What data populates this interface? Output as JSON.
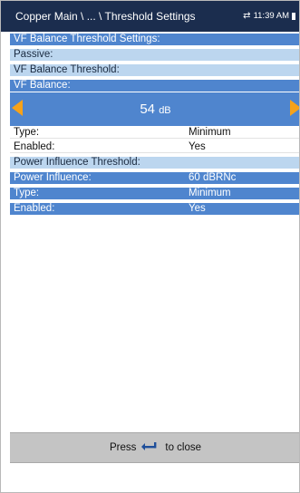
{
  "header": {
    "breadcrumb": "Copper Main \\ ... \\ Threshold Settings",
    "time": "11:39 AM"
  },
  "sections": {
    "vf_settings_title": "VF Balance Threshold Settings:",
    "passive_label": "Passive:",
    "vf_threshold_title": "VF Balance Threshold:",
    "vf_balance_label": "VF Balance:"
  },
  "editor": {
    "value": "54",
    "unit": "dB"
  },
  "vf_rows": [
    {
      "label": "Type:",
      "value": "Minimum"
    },
    {
      "label": "Enabled:",
      "value": "Yes"
    }
  ],
  "power": {
    "title": "Power Influence Threshold:",
    "rows": [
      {
        "label": "Power Influence:",
        "value": "60 dBRNc"
      },
      {
        "label": "Type:",
        "value": "Minimum"
      },
      {
        "label": "Enabled:",
        "value": "Yes"
      }
    ]
  },
  "footer": {
    "press": "Press",
    "to_close": "to close"
  },
  "colors": {
    "title_bar": "#1b2d4e",
    "selected_row": "#4f85ce",
    "section_row": "#bcd6ef",
    "arrow": "#f6a21a",
    "footer": "#c4c4c4"
  }
}
